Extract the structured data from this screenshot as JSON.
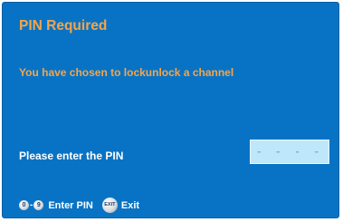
{
  "dialog": {
    "title": "PIN Required",
    "message": "You have chosen to lockunlock a channel",
    "prompt": "Please enter the PIN",
    "pin_placeholder": "- - - -"
  },
  "footer": {
    "key_first": "0",
    "key_separator": "-",
    "key_last": "9",
    "enter_pin_label": "Enter PIN",
    "exit_key": "EXIT",
    "exit_label": "Exit"
  },
  "icons": {
    "digit_key": "digit-key-icon",
    "exit_key": "exit-key-icon"
  },
  "colors": {
    "panel_background": "#0873c4",
    "accent_text": "#f5a54a",
    "field_background": "#bfe7fa"
  }
}
